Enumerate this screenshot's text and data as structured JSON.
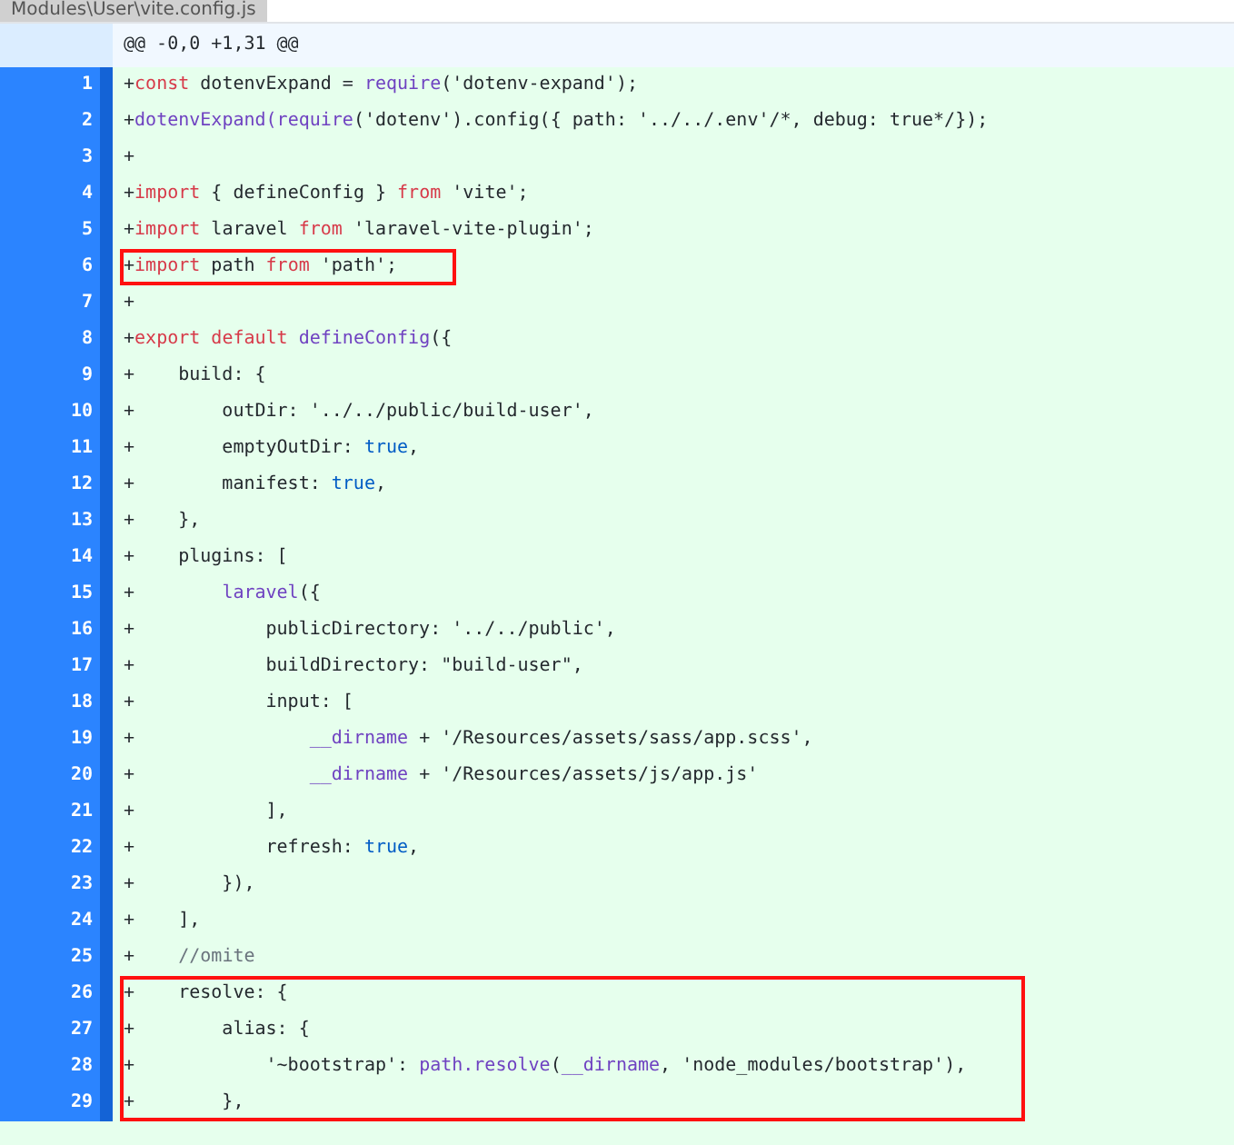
{
  "file_title": "Modules\\User\\vite.config.js",
  "hunk_header": "@@ -0,0 +1,31 @@",
  "lines": [
    {
      "number": "1",
      "boxed": false,
      "tokens": [
        {
          "text": "+",
          "kind": "plain"
        },
        {
          "text": "const",
          "kind": "keyword"
        },
        {
          "text": " dotenvExpand = ",
          "kind": "plain"
        },
        {
          "text": "require",
          "kind": "function"
        },
        {
          "text": "('dotenv-expand');",
          "kind": "plain"
        }
      ]
    },
    {
      "number": "2",
      "boxed": false,
      "tokens": [
        {
          "text": "+",
          "kind": "plain"
        },
        {
          "text": "dotenvExpand(require",
          "kind": "function"
        },
        {
          "text": "('dotenv').config({ path: '../../.env'/*, debug: true*/});",
          "kind": "plain"
        }
      ]
    },
    {
      "number": "3",
      "boxed": false,
      "tokens": [
        {
          "text": "+",
          "kind": "plain"
        }
      ]
    },
    {
      "number": "4",
      "boxed": false,
      "tokens": [
        {
          "text": "+",
          "kind": "plain"
        },
        {
          "text": "import",
          "kind": "keyword"
        },
        {
          "text": " { defineConfig } ",
          "kind": "plain"
        },
        {
          "text": "from",
          "kind": "keyword"
        },
        {
          "text": " 'vite';",
          "kind": "plain"
        }
      ]
    },
    {
      "number": "5",
      "boxed": false,
      "tokens": [
        {
          "text": "+",
          "kind": "plain"
        },
        {
          "text": "import",
          "kind": "keyword"
        },
        {
          "text": " laravel ",
          "kind": "plain"
        },
        {
          "text": "from",
          "kind": "keyword"
        },
        {
          "text": " 'laravel-vite-plugin';",
          "kind": "plain"
        }
      ]
    },
    {
      "number": "6",
      "boxed": true,
      "tokens": [
        {
          "text": "+",
          "kind": "plain"
        },
        {
          "text": "import",
          "kind": "keyword"
        },
        {
          "text": " path ",
          "kind": "plain"
        },
        {
          "text": "from",
          "kind": "keyword"
        },
        {
          "text": " 'path';",
          "kind": "plain"
        }
      ]
    },
    {
      "number": "7",
      "boxed": false,
      "tokens": [
        {
          "text": "+",
          "kind": "plain"
        }
      ]
    },
    {
      "number": "8",
      "boxed": false,
      "tokens": [
        {
          "text": "+",
          "kind": "plain"
        },
        {
          "text": "export default",
          "kind": "keyword"
        },
        {
          "text": " defineConfig",
          "kind": "function"
        },
        {
          "text": "({",
          "kind": "plain"
        }
      ]
    },
    {
      "number": "9",
      "boxed": false,
      "tokens": [
        {
          "text": "+    build: {",
          "kind": "plain"
        }
      ]
    },
    {
      "number": "10",
      "boxed": false,
      "tokens": [
        {
          "text": "+        outDir: '../../public/build-user',",
          "kind": "plain"
        }
      ]
    },
    {
      "number": "11",
      "boxed": false,
      "tokens": [
        {
          "text": "+        emptyOutDir: ",
          "kind": "plain"
        },
        {
          "text": "true",
          "kind": "boolean"
        },
        {
          "text": ",",
          "kind": "plain"
        }
      ]
    },
    {
      "number": "12",
      "boxed": false,
      "tokens": [
        {
          "text": "+        manifest: ",
          "kind": "plain"
        },
        {
          "text": "true",
          "kind": "boolean"
        },
        {
          "text": ",",
          "kind": "plain"
        }
      ]
    },
    {
      "number": "13",
      "boxed": false,
      "tokens": [
        {
          "text": "+    },",
          "kind": "plain"
        }
      ]
    },
    {
      "number": "14",
      "boxed": false,
      "tokens": [
        {
          "text": "+    plugins: [",
          "kind": "plain"
        }
      ]
    },
    {
      "number": "15",
      "boxed": false,
      "tokens": [
        {
          "text": "+        ",
          "kind": "plain"
        },
        {
          "text": "laravel",
          "kind": "function"
        },
        {
          "text": "({",
          "kind": "plain"
        }
      ]
    },
    {
      "number": "16",
      "boxed": false,
      "tokens": [
        {
          "text": "+            publicDirectory: '../../public',",
          "kind": "plain"
        }
      ]
    },
    {
      "number": "17",
      "boxed": false,
      "tokens": [
        {
          "text": "+            buildDirectory: \"build-user\",",
          "kind": "plain"
        }
      ]
    },
    {
      "number": "18",
      "boxed": false,
      "tokens": [
        {
          "text": "+            input: [",
          "kind": "plain"
        }
      ]
    },
    {
      "number": "19",
      "boxed": false,
      "tokens": [
        {
          "text": "+                ",
          "kind": "plain"
        },
        {
          "text": "__dirname",
          "kind": "function"
        },
        {
          "text": " + '/Resources/assets/sass/app.scss',",
          "kind": "plain"
        }
      ]
    },
    {
      "number": "20",
      "boxed": false,
      "tokens": [
        {
          "text": "+                ",
          "kind": "plain"
        },
        {
          "text": "__dirname",
          "kind": "function"
        },
        {
          "text": " + '/Resources/assets/js/app.js'",
          "kind": "plain"
        }
      ]
    },
    {
      "number": "21",
      "boxed": false,
      "tokens": [
        {
          "text": "+            ],",
          "kind": "plain"
        }
      ]
    },
    {
      "number": "22",
      "boxed": false,
      "tokens": [
        {
          "text": "+            refresh: ",
          "kind": "plain"
        },
        {
          "text": "true",
          "kind": "boolean"
        },
        {
          "text": ",",
          "kind": "plain"
        }
      ]
    },
    {
      "number": "23",
      "boxed": false,
      "tokens": [
        {
          "text": "+        }),",
          "kind": "plain"
        }
      ]
    },
    {
      "number": "24",
      "boxed": false,
      "tokens": [
        {
          "text": "+    ],",
          "kind": "plain"
        }
      ]
    },
    {
      "number": "25",
      "boxed": false,
      "tokens": [
        {
          "text": "+    ",
          "kind": "plain"
        },
        {
          "text": "//omite",
          "kind": "comment"
        }
      ]
    },
    {
      "number": "26",
      "boxed": true,
      "tokens": [
        {
          "text": "+    resolve: {",
          "kind": "plain"
        }
      ]
    },
    {
      "number": "27",
      "boxed": true,
      "tokens": [
        {
          "text": "+        alias: {",
          "kind": "plain"
        }
      ]
    },
    {
      "number": "28",
      "boxed": true,
      "tokens": [
        {
          "text": "+            '~bootstrap': ",
          "kind": "plain"
        },
        {
          "text": "path.resolve",
          "kind": "function"
        },
        {
          "text": "(",
          "kind": "plain"
        },
        {
          "text": "__dirname",
          "kind": "function"
        },
        {
          "text": ", 'node_modules/bootstrap'),",
          "kind": "plain"
        }
      ]
    },
    {
      "number": "29",
      "boxed": true,
      "tokens": [
        {
          "text": "+        },",
          "kind": "plain"
        }
      ]
    }
  ]
}
